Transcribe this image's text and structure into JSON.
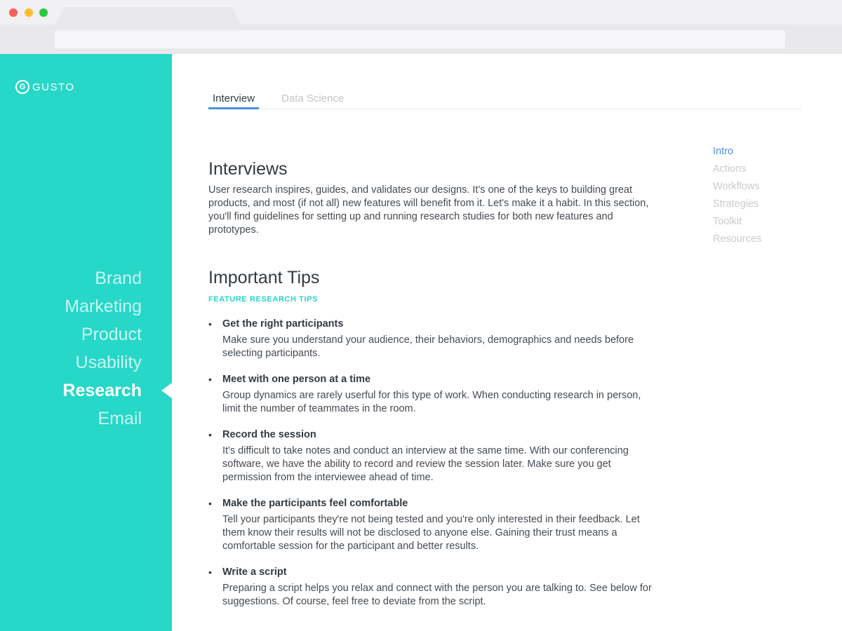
{
  "colors": {
    "brand": "#27d7c8",
    "accent": "#4a90e2"
  },
  "logo": {
    "mark": "G",
    "text": "GUSTO"
  },
  "sidebar": {
    "items": [
      {
        "label": "Brand"
      },
      {
        "label": "Marketing"
      },
      {
        "label": "Product"
      },
      {
        "label": "Usability"
      },
      {
        "label": "Research",
        "active": true
      },
      {
        "label": "Email"
      }
    ]
  },
  "tabs": [
    {
      "label": "Interview",
      "active": true
    },
    {
      "label": "Data Science"
    }
  ],
  "intro": {
    "title": "Interviews",
    "body": "User research inspires, guides, and validates our designs. It's one of the keys to building great products, and most (if not all) new features will benefit from it. Let's make it a habit. In this section, you'll find guidelines for setting up and running research studies for both new features and prototypes."
  },
  "tips_section": {
    "title": "Important Tips",
    "subhead": "FEATURE RESEARCH TIPS",
    "items": [
      {
        "title": "Get the right participants",
        "body": "Make sure you understand your audience, their behaviors, demographics and needs before selecting participants."
      },
      {
        "title": "Meet with one person at a time",
        "body": "Group dynamics are rarely userful for this type of work. When conducting research in person, limit the number of teammates in the room."
      },
      {
        "title": "Record the session",
        "body": "It's difficult to take notes and conduct an interview at the same time. With our conferencing software, we have the ability to record and review the session later. Make sure you get permission from the interviewee ahead of time."
      },
      {
        "title": "Make the participants feel comfortable",
        "body": "Tell your participants they're not being tested and you're only interested in their feedback. Let them know their results will not be disclosed to anyone else. Gaining their trust means a comfortable session for the participant and better results."
      },
      {
        "title": "Write a script",
        "body": "Preparing a script helps you relax and connect with the person you are talking to. See below for suggestions. Of course, feel free to deviate from the script."
      }
    ]
  },
  "toc": [
    {
      "label": "Intro",
      "active": true
    },
    {
      "label": "Actions"
    },
    {
      "label": "Workflows"
    },
    {
      "label": "Strategies"
    },
    {
      "label": "Toolkit"
    },
    {
      "label": "Resources"
    }
  ]
}
